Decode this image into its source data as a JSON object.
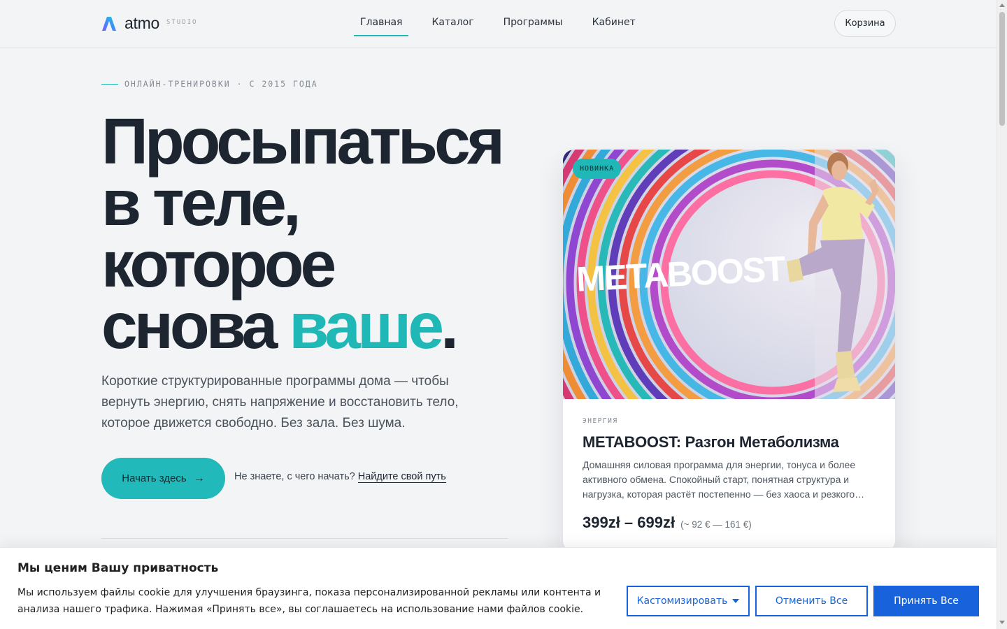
{
  "header": {
    "logo_text": "atmo",
    "logo_sub": "STUDIO",
    "nav": [
      {
        "label": "Главная",
        "active": true
      },
      {
        "label": "Каталог",
        "active": false
      },
      {
        "label": "Программы",
        "active": false
      },
      {
        "label": "Кабинет",
        "active": false
      }
    ],
    "cart_label": "Корзина"
  },
  "hero": {
    "eyebrow": "ОНЛАЙН-ТРЕНИРОВКИ · С 2015 ГОДА",
    "headline_line1": "Просыпаться",
    "headline_line2": "в теле,",
    "headline_line3": "которое",
    "headline_line4_start": "снова ",
    "headline_accent": "ваше",
    "headline_end": ".",
    "lead": "Короткие структурированные программы дома — чтобы вернуть энергию, снять напряжение и восстановить тело, которое движется свободно. Без зала. Без шума.",
    "cta_label": "Начать здесь",
    "cta_arrow": "→",
    "help_text": "Не знаете, с чего начать?",
    "help_link": "Найдите свой путь"
  },
  "product": {
    "badge": "НОВИНКА",
    "image_word": "METABOOST",
    "category": "ЭНЕРГИЯ",
    "title": "METABOOST: Разгон Метаболизма",
    "description": "Домашняя силовая программа для энергии, тонуса и более активного обмена. Спокойный старт, понятная структура и нагрузка, которая растёт постепенно — без хаоса и резкого…",
    "price": "399zł – 699zł",
    "price_eur": "(~ 92 € — 161 €)"
  },
  "cookie": {
    "title": "Мы ценим Вашу приватность",
    "text": "Мы используем файлы cookie для улучшения браузинга, показа персонализированной рекламы или контента и анализа нашего трафика. Нажимая «Принять все», вы соглашаетесь на использование нами файлов cookie.",
    "customize_label": "Кастомизировать",
    "reject_label": "Отменить Все",
    "accept_label": "Принять Все"
  },
  "colors": {
    "accent": "#1fb8b6",
    "ink": "#1c2530",
    "cookie_blue": "#1863dc"
  }
}
